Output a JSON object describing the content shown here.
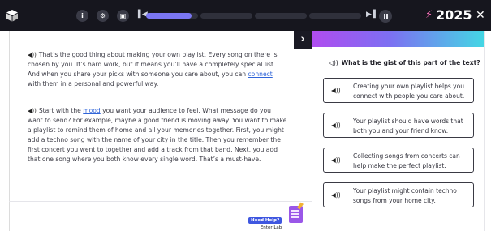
{
  "topbar": {
    "logo_icon": "cube-logo-icon",
    "buttons": [
      {
        "name": "info-button",
        "glyph": "i"
      },
      {
        "name": "settings-button",
        "glyph": "⚙"
      },
      {
        "name": "captions-button",
        "glyph": "▣"
      }
    ],
    "progress_fraction": 0.22,
    "score": "2025",
    "score_icon": "lightning-bolt-icon",
    "close_icon": "close-icon"
  },
  "passage": {
    "p1": {
      "before": "That’s the good thing about making your own playlist. Every song on there is chosen by you. It’s hard work, but it means you’ll have a completely special list. And when you share your picks with someone you care about, you can ",
      "keyword": "connect",
      "after": " with them in a personal and powerful way."
    },
    "p2": {
      "before": "Start with the ",
      "keyword": "mood",
      "after": " you want your audience to feel. What message do you want to send? For example, maybe a good friend is moving away. You want to make a playlist to remind them of home and all your memories together. First, you might add a techno song with the name of your city in the title. Then you remember the first concert you went to together and add a track from that band. Next, you add that one song where you both know every single word. That’s a must-have."
    },
    "help": {
      "line1": "Need Help?",
      "line2": "Enter Lab"
    }
  },
  "question": {
    "prompt": "What is the gist of this part of the text?",
    "options": [
      "Creating your own playlist helps you connect with people you care about.",
      "Your playlist should have words that both you and your friend know.",
      "Collecting songs from concerts can help make the perfect playlist.",
      "Your playlist might contain techno songs from your home city."
    ]
  }
}
